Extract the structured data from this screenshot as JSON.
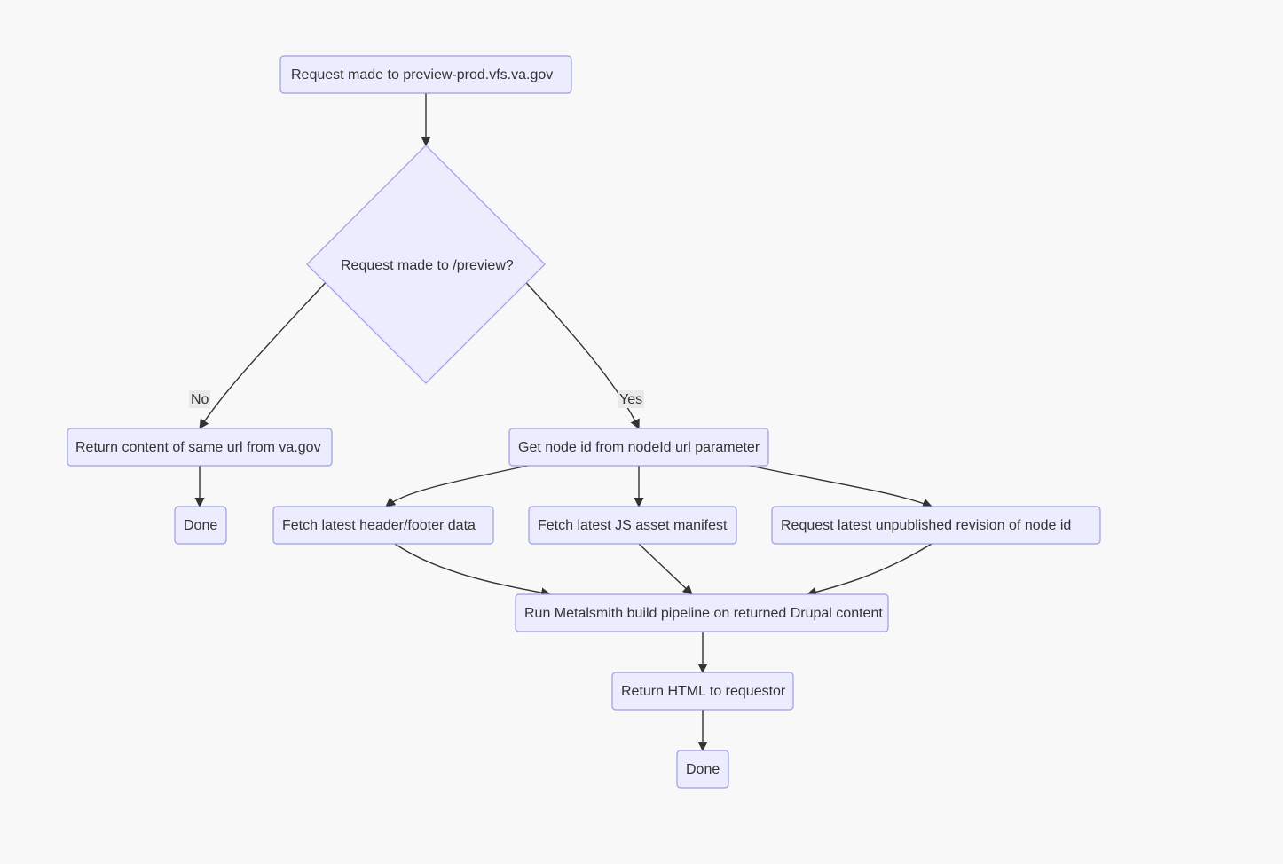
{
  "chart_data": {
    "type": "flowchart",
    "nodes": [
      {
        "id": "start",
        "shape": "rect",
        "label": "Request made to preview-prod.vfs.va.gov"
      },
      {
        "id": "decision",
        "shape": "diamond",
        "label": "Request made to /preview?"
      },
      {
        "id": "no_return",
        "shape": "rect",
        "label": "Return content of same url from va.gov"
      },
      {
        "id": "no_done",
        "shape": "rect",
        "label": "Done"
      },
      {
        "id": "get_node",
        "shape": "rect",
        "label": "Get node id from nodeId url parameter"
      },
      {
        "id": "fetch_hf",
        "shape": "rect",
        "label": "Fetch latest header/footer data"
      },
      {
        "id": "fetch_js",
        "shape": "rect",
        "label": "Fetch latest JS asset manifest"
      },
      {
        "id": "fetch_rev",
        "shape": "rect",
        "label": "Request latest unpublished revision of node id"
      },
      {
        "id": "metalsmith",
        "shape": "rect",
        "label": "Run Metalsmith build pipeline on returned Drupal content"
      },
      {
        "id": "ret_html",
        "shape": "rect",
        "label": "Return HTML to requestor"
      },
      {
        "id": "yes_done",
        "shape": "rect",
        "label": "Done"
      }
    ],
    "edges": [
      {
        "from": "start",
        "to": "decision",
        "label": ""
      },
      {
        "from": "decision",
        "to": "no_return",
        "label": "No"
      },
      {
        "from": "decision",
        "to": "get_node",
        "label": "Yes"
      },
      {
        "from": "no_return",
        "to": "no_done",
        "label": ""
      },
      {
        "from": "get_node",
        "to": "fetch_hf",
        "label": ""
      },
      {
        "from": "get_node",
        "to": "fetch_js",
        "label": ""
      },
      {
        "from": "get_node",
        "to": "fetch_rev",
        "label": ""
      },
      {
        "from": "fetch_hf",
        "to": "metalsmith",
        "label": ""
      },
      {
        "from": "fetch_js",
        "to": "metalsmith",
        "label": ""
      },
      {
        "from": "fetch_rev",
        "to": "metalsmith",
        "label": ""
      },
      {
        "from": "metalsmith",
        "to": "ret_html",
        "label": ""
      },
      {
        "from": "ret_html",
        "to": "yes_done",
        "label": ""
      }
    ]
  },
  "labels": {
    "start": "Request made to preview-prod.vfs.va.gov",
    "decision": "Request made to /preview?",
    "no_return": "Return content of same url from va.gov",
    "no_done": "Done",
    "get_node": "Get node id from nodeId url parameter",
    "fetch_hf": "Fetch latest header/footer data",
    "fetch_js": "Fetch latest JS asset manifest",
    "fetch_rev": "Request latest unpublished revision of node id",
    "metalsmith": "Run Metalsmith build pipeline on returned Drupal content",
    "ret_html": "Return HTML to requestor",
    "yes_done": "Done",
    "edge_no": "No",
    "edge_yes": "Yes"
  }
}
